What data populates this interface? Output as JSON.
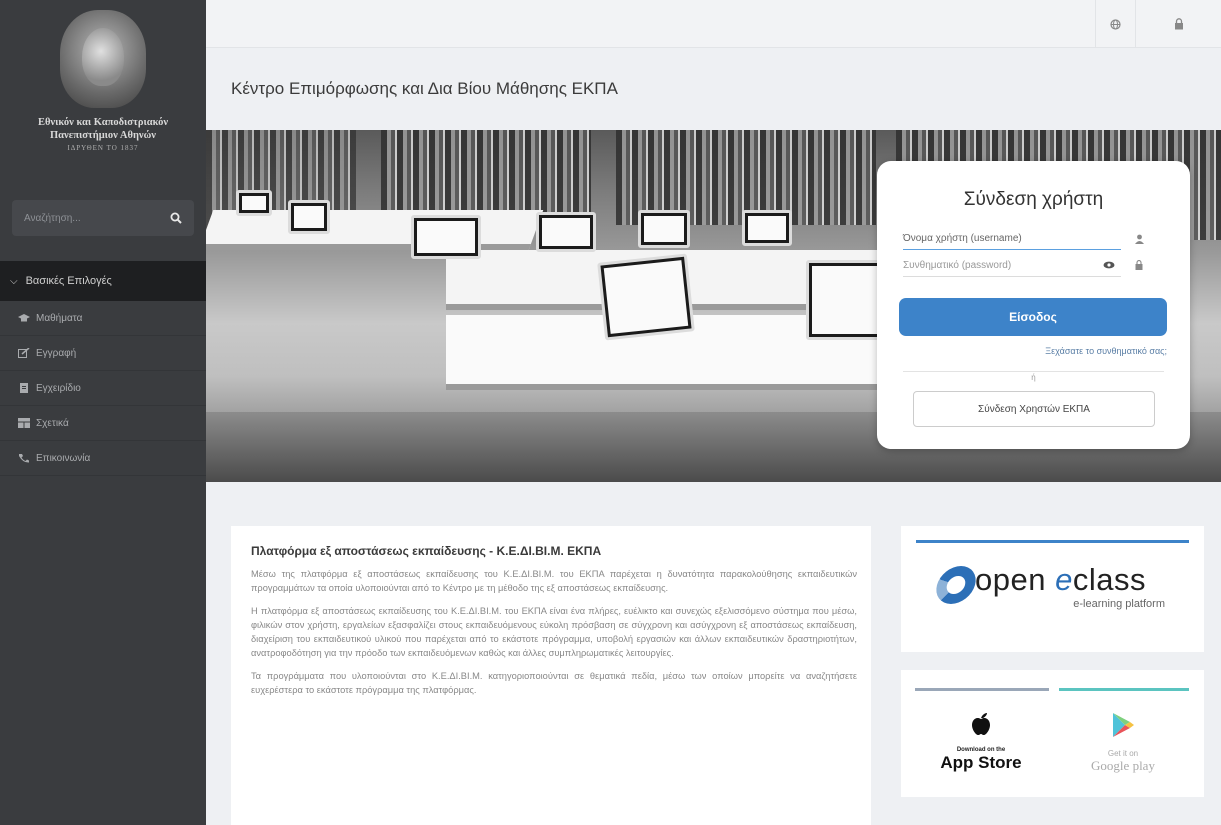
{
  "sidebar": {
    "logo_text": "Εθνικόν και Καποδιστριακόν",
    "logo_text2": "Πανεπιστήμιον Αθηνών",
    "logo_sub": "ΙΔΡΥΘΕΝ ΤΟ 1837",
    "search_placeholder": "Αναζήτηση...",
    "menu_header": "Βασικές Επιλογές",
    "items": [
      {
        "label": "Μαθήματα",
        "icon": "graduation-cap-icon"
      },
      {
        "label": "Εγγραφή",
        "icon": "edit-icon"
      },
      {
        "label": "Εγχειρίδιο",
        "icon": "file-icon"
      },
      {
        "label": "Σχετικά",
        "icon": "table-icon"
      },
      {
        "label": "Επικοινωνία",
        "icon": "phone-icon"
      }
    ]
  },
  "topbar": {
    "language_icon": "globe-icon",
    "login_icon": "lock-icon"
  },
  "page_title": "Κέντρο Επιμόρφωσης και Δια Βίου Μάθησης ΕΚΠΑ",
  "login": {
    "title": "Σύνδεση χρήστη",
    "username_placeholder": "Όνομα χρήστη (username)",
    "password_placeholder": "Συνθηματικό (password)",
    "submit": "Είσοδος",
    "forgot": "Ξεχάσατε το συνθηματικό σας;",
    "divider": "ή",
    "ekpa_login": "Σύνδεση Χρηστών ΕΚΠΑ"
  },
  "content": {
    "heading": "Πλατφόρμα εξ αποστάσεως εκπαίδευσης - Κ.Ε.ΔΙ.ΒΙ.Μ. ΕΚΠΑ",
    "p1": "Μέσω της πλατφόρμα εξ αποστάσεως εκπαίδευσης του Κ.Ε.ΔΙ.ΒΙ.Μ. του ΕΚΠΑ παρέχεται η δυνατότητα παρακολούθησης εκπαιδευτικών προγραμμάτων τα οποία υλοποιούνται από το Κέντρο με τη μέθοδο της εξ αποστάσεως εκπαίδευσης.",
    "p2": "Η πλατφόρμα εξ αποστάσεως εκπαίδευσης του Κ.Ε.ΔΙ.ΒΙ.Μ. του ΕΚΠΑ είναι ένα πλήρες, ευέλικτο και συνεχώς εξελισσόμενο σύστημα που μέσω, φιλικών στον χρήστη, εργαλείων εξασφαλίζει στους εκπαιδευόμενους εύκολη πρόσβαση σε σύγχρονη και ασύγχρονη εξ αποστάσεως εκπαίδευση, διαχείριση του εκπαιδευτικού υλικού που παρέχεται από το εκάστοτε πρόγραμμα, υποβολή εργασιών και άλλων εκπαιδευτικών δραστηριοτήτων, ανατροφοδότηση για την πρόοδο των εκπαιδευόμενων καθώς και άλλες συμπληρωματικές λειτουργίες.",
    "p3": "Τα προγράμματα που υλοποιούνται στο Κ.Ε.ΔΙ.ΒΙ.Μ. κατηγοριοποιούνται σε θεματικά πεδία, μέσω των οποίων μπορείτε να αναζητήσετε ευχερέστερα το εκάστοτε πρόγραμμα της πλατφόρμας."
  },
  "eclass": {
    "word_open": "open ",
    "word_e": "e",
    "word_class": "class",
    "tagline": "e-learning platform"
  },
  "stores": {
    "apple_small": "Download on the",
    "apple_big": "App Store",
    "google_small": "Get it on",
    "google_big": "Google play"
  }
}
